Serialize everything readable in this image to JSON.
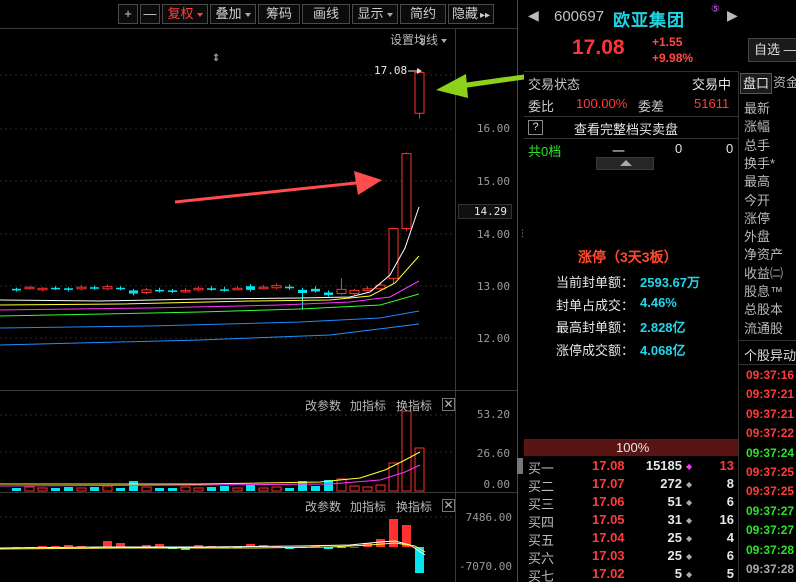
{
  "toolbar": {
    "plus": "+",
    "minus": "—",
    "fuquan": "复权",
    "diejia": "叠加",
    "chouma": "筹码",
    "huaxian": "画线",
    "xianshi": "显示",
    "jianyue": "简约",
    "yincang": "隐藏",
    "more": "▸▸"
  },
  "chart": {
    "settings_label": "设置均线",
    "price_marker": "17.08",
    "price_axis": [
      "16.00",
      "15.00",
      "14.00",
      "13.00",
      "12.00"
    ],
    "price_current_tag": "14.29",
    "vol_axis": [
      "53.20",
      "26.60",
      "0.00"
    ],
    "macd_axis": [
      "7486.00",
      "-7070.00"
    ],
    "sub_toolbar": {
      "params": "改参数",
      "add": "加指标",
      "switch": "换指标",
      "close": "✕"
    },
    "colors": {
      "up": "#ff3030",
      "down": "#00e5ee",
      "ma5": "#ffffff",
      "ma10": "#ffff33",
      "ma20": "#ff33ff",
      "ma60": "#33ff33",
      "ma120": "#2288ff"
    }
  },
  "stock": {
    "code": "600697",
    "name": "欧亚集团",
    "badge": "⑤",
    "price": "17.08",
    "change": "+1.55",
    "change_pct": "+9.98%",
    "watch_button": "自选 —"
  },
  "status": {
    "trade_state_label": "交易状态",
    "trade_state_value": "交易中",
    "weibi_label": "委比",
    "weibi_value": "100.00%",
    "weicha_label": "委差",
    "weicha_value": "51611",
    "full_book_link": "查看完整档买卖盘",
    "help_icon": "?",
    "levels_label": "共0档",
    "levels_dash": "一",
    "levels_v1": "0",
    "levels_v2": "0"
  },
  "limit_up": {
    "title": "涨停（3天3板）",
    "rows": [
      {
        "label": "当前封单额：",
        "value": "2593.67万"
      },
      {
        "label": "封单占成交：",
        "value": "4.46%"
      },
      {
        "label": "最高封单额：",
        "value": "2.828亿"
      },
      {
        "label": "涨停成交额：",
        "value": "4.068亿"
      }
    ]
  },
  "orderbook": {
    "ratio": "100%",
    "rows": [
      {
        "label": "买一",
        "price": "17.08",
        "vol": "15185",
        "mark": "◆",
        "chg": "13"
      },
      {
        "label": "买二",
        "price": "17.07",
        "vol": "272",
        "mark": "◆",
        "chg": "8"
      },
      {
        "label": "买三",
        "price": "17.06",
        "vol": "51",
        "mark": "◆",
        "chg": "6"
      },
      {
        "label": "买四",
        "price": "17.05",
        "vol": "31",
        "mark": "◆",
        "chg": "16"
      },
      {
        "label": "买五",
        "price": "17.04",
        "vol": "25",
        "mark": "◆",
        "chg": "4"
      },
      {
        "label": "买六",
        "price": "17.03",
        "vol": "25",
        "mark": "◆",
        "chg": "6"
      },
      {
        "label": "买七",
        "price": "17.02",
        "vol": "5",
        "mark": "◆",
        "chg": "5"
      }
    ]
  },
  "side_tabs": {
    "pankou": "盘口",
    "zijin": "资金"
  },
  "side_fields": [
    "最新",
    "涨幅",
    "总手",
    "换手*",
    "最高",
    "今开",
    "涨停",
    "外盘",
    "净资产",
    "收益㈡",
    "股息™",
    "总股本",
    "流通股"
  ],
  "anomaly": {
    "title": "个股异动",
    "times": [
      {
        "t": "09:37:16",
        "c": "red"
      },
      {
        "t": "09:37:21",
        "c": "red"
      },
      {
        "t": "09:37:21",
        "c": "red"
      },
      {
        "t": "09:37:22",
        "c": "red"
      },
      {
        "t": "09:37:24",
        "c": "green"
      },
      {
        "t": "09:37:25",
        "c": "red"
      },
      {
        "t": "09:37:25",
        "c": "red"
      },
      {
        "t": "09:37:27",
        "c": "green"
      },
      {
        "t": "09:37:27",
        "c": "green"
      },
      {
        "t": "09:37:28",
        "c": "green"
      },
      {
        "t": "09:37:28",
        "c": "gray"
      }
    ]
  }
}
